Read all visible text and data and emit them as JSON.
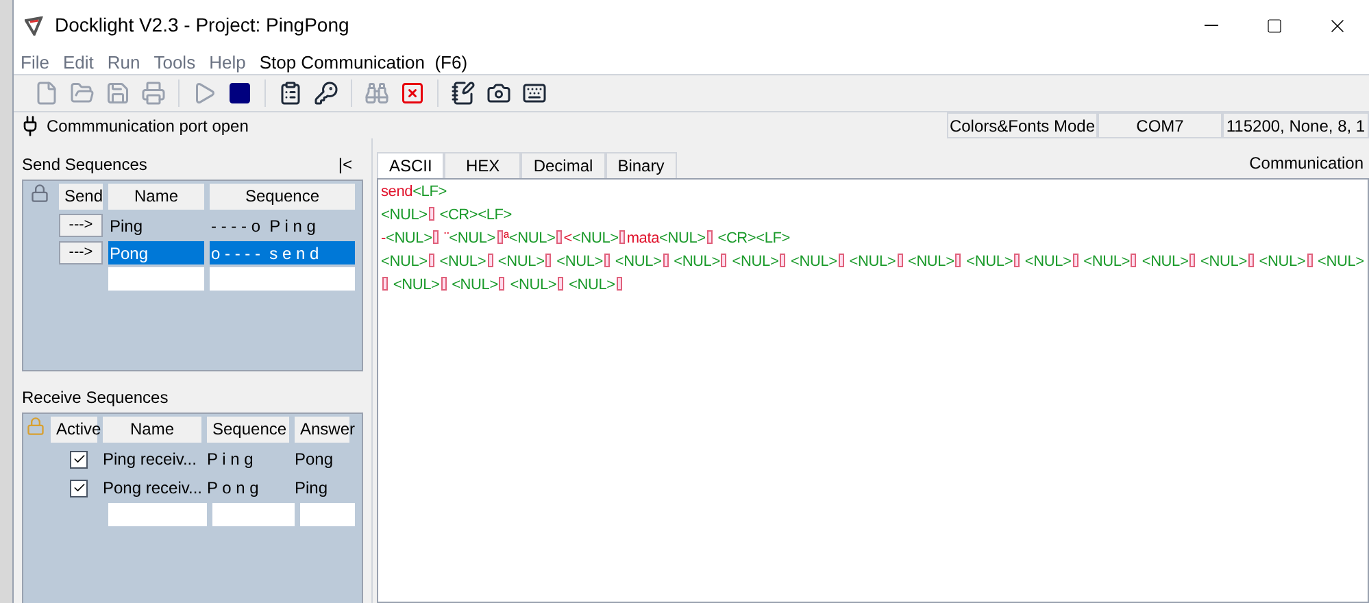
{
  "window": {
    "title": "Docklight V2.3 - Project: PingPong"
  },
  "menu": [
    {
      "label": "File",
      "disabled": true
    },
    {
      "label": "Edit",
      "disabled": true
    },
    {
      "label": "Run",
      "disabled": true
    },
    {
      "label": "Tools",
      "disabled": true
    },
    {
      "label": "Help",
      "disabled": true
    },
    {
      "label": "Stop Communication  (F6)",
      "disabled": false
    }
  ],
  "toolbar": [
    {
      "kind": "new",
      "disabled": true
    },
    {
      "kind": "open",
      "disabled": true
    },
    {
      "kind": "save",
      "disabled": true
    },
    {
      "kind": "print",
      "disabled": true
    },
    {
      "kind": "sep"
    },
    {
      "kind": "play",
      "disabled": true
    },
    {
      "kind": "stop",
      "disabled": false
    },
    {
      "kind": "sep"
    },
    {
      "kind": "settings",
      "disabled": false
    },
    {
      "kind": "key",
      "disabled": false
    },
    {
      "kind": "sep"
    },
    {
      "kind": "find",
      "disabled": true
    },
    {
      "kind": "clear",
      "disabled": false
    },
    {
      "kind": "sep"
    },
    {
      "kind": "notes",
      "disabled": false
    },
    {
      "kind": "camera",
      "disabled": false
    },
    {
      "kind": "keyboard",
      "disabled": false
    }
  ],
  "status_bar": {
    "message": "Commmunication port open",
    "mode": "Colors&Fonts Mode",
    "port": "COM7",
    "settings": "115200, None, 8, 1"
  },
  "send_sequences": {
    "title": "Send Sequences",
    "collapse": "|<",
    "columns": [
      "Send",
      "Name",
      "Sequence"
    ],
    "rows": [
      {
        "button": "--->",
        "name": "Ping",
        "sequence": "- - - - o  P i n g",
        "selected": false
      },
      {
        "button": "--->",
        "name": "Pong",
        "sequence": "o - - - -  s e n d",
        "selected": true
      }
    ]
  },
  "receive_sequences": {
    "title": "Receive Sequences",
    "columns": [
      "Active",
      "Name",
      "Sequence",
      "Answer"
    ],
    "rows": [
      {
        "checked": true,
        "name": "Ping receiv...",
        "sequence": "P i n g",
        "answer": "Pong"
      },
      {
        "checked": true,
        "name": "Pong receiv...",
        "sequence": "P o n g",
        "answer": "Ping"
      }
    ]
  },
  "tabs": [
    {
      "label": "ASCII",
      "selected": true
    },
    {
      "label": "HEX",
      "selected": false
    },
    {
      "label": "Decimal",
      "selected": false
    },
    {
      "label": "Binary",
      "selected": false
    }
  ],
  "communication_label": "Communication",
  "log": [
    [
      {
        "kind": "sent",
        "text": "send"
      },
      {
        "kind": "received",
        "text": "<LF>"
      }
    ],
    [
      {
        "kind": "received",
        "text": "<NUL>"
      },
      {
        "kind": "box"
      },
      {
        "kind": "received",
        "text": " <CR><LF>"
      }
    ],
    [
      {
        "kind": "sent",
        "text": "-"
      },
      {
        "kind": "received",
        "text": "<NUL>"
      },
      {
        "kind": "box"
      },
      {
        "kind": "sent",
        "text": " ¨"
      },
      {
        "kind": "received",
        "text": "<NUL>"
      },
      {
        "kind": "box"
      },
      {
        "kind": "sent",
        "text": "ª"
      },
      {
        "kind": "received",
        "text": "<NUL>"
      },
      {
        "kind": "box"
      },
      {
        "kind": "sent",
        "text": "<"
      },
      {
        "kind": "received",
        "text": "<NUL>"
      },
      {
        "kind": "box"
      },
      {
        "kind": "sent",
        "text": "mata"
      },
      {
        "kind": "received",
        "text": "<NUL>"
      },
      {
        "kind": "box"
      },
      {
        "kind": "received",
        "text": " <CR><LF>"
      }
    ],
    [
      {
        "kind": "received",
        "text": "<NUL>"
      },
      {
        "kind": "box"
      },
      {
        "kind": "received",
        "text": " <NUL>"
      },
      {
        "kind": "box"
      },
      {
        "kind": "received",
        "text": " <NUL>"
      },
      {
        "kind": "box"
      },
      {
        "kind": "received",
        "text": " <NUL>"
      },
      {
        "kind": "box"
      },
      {
        "kind": "received",
        "text": " <NUL>"
      },
      {
        "kind": "box"
      },
      {
        "kind": "received",
        "text": " <NUL>"
      },
      {
        "kind": "box"
      },
      {
        "kind": "received",
        "text": " <NUL>"
      },
      {
        "kind": "box"
      },
      {
        "kind": "received",
        "text": " <NUL>"
      },
      {
        "kind": "box"
      },
      {
        "kind": "received",
        "text": " <NUL>"
      },
      {
        "kind": "box"
      },
      {
        "kind": "received",
        "text": " <NUL>"
      },
      {
        "kind": "box"
      },
      {
        "kind": "received",
        "text": " <NUL>"
      },
      {
        "kind": "box"
      },
      {
        "kind": "received",
        "text": " <NUL>"
      },
      {
        "kind": "box"
      },
      {
        "kind": "received",
        "text": " <NUL>"
      },
      {
        "kind": "box"
      },
      {
        "kind": "received",
        "text": " <NUL>"
      },
      {
        "kind": "box"
      },
      {
        "kind": "received",
        "text": " <NUL>"
      },
      {
        "kind": "box"
      },
      {
        "kind": "received",
        "text": " <NUL>"
      },
      {
        "kind": "box"
      },
      {
        "kind": "received",
        "text": " <NUL>"
      }
    ],
    [
      {
        "kind": "box"
      },
      {
        "kind": "received",
        "text": " <NUL>"
      },
      {
        "kind": "box"
      },
      {
        "kind": "received",
        "text": " <NUL>"
      },
      {
        "kind": "box"
      },
      {
        "kind": "received",
        "text": " <NUL>"
      },
      {
        "kind": "box"
      },
      {
        "kind": "received",
        "text": " <NUL>"
      },
      {
        "kind": "box"
      }
    ]
  ]
}
